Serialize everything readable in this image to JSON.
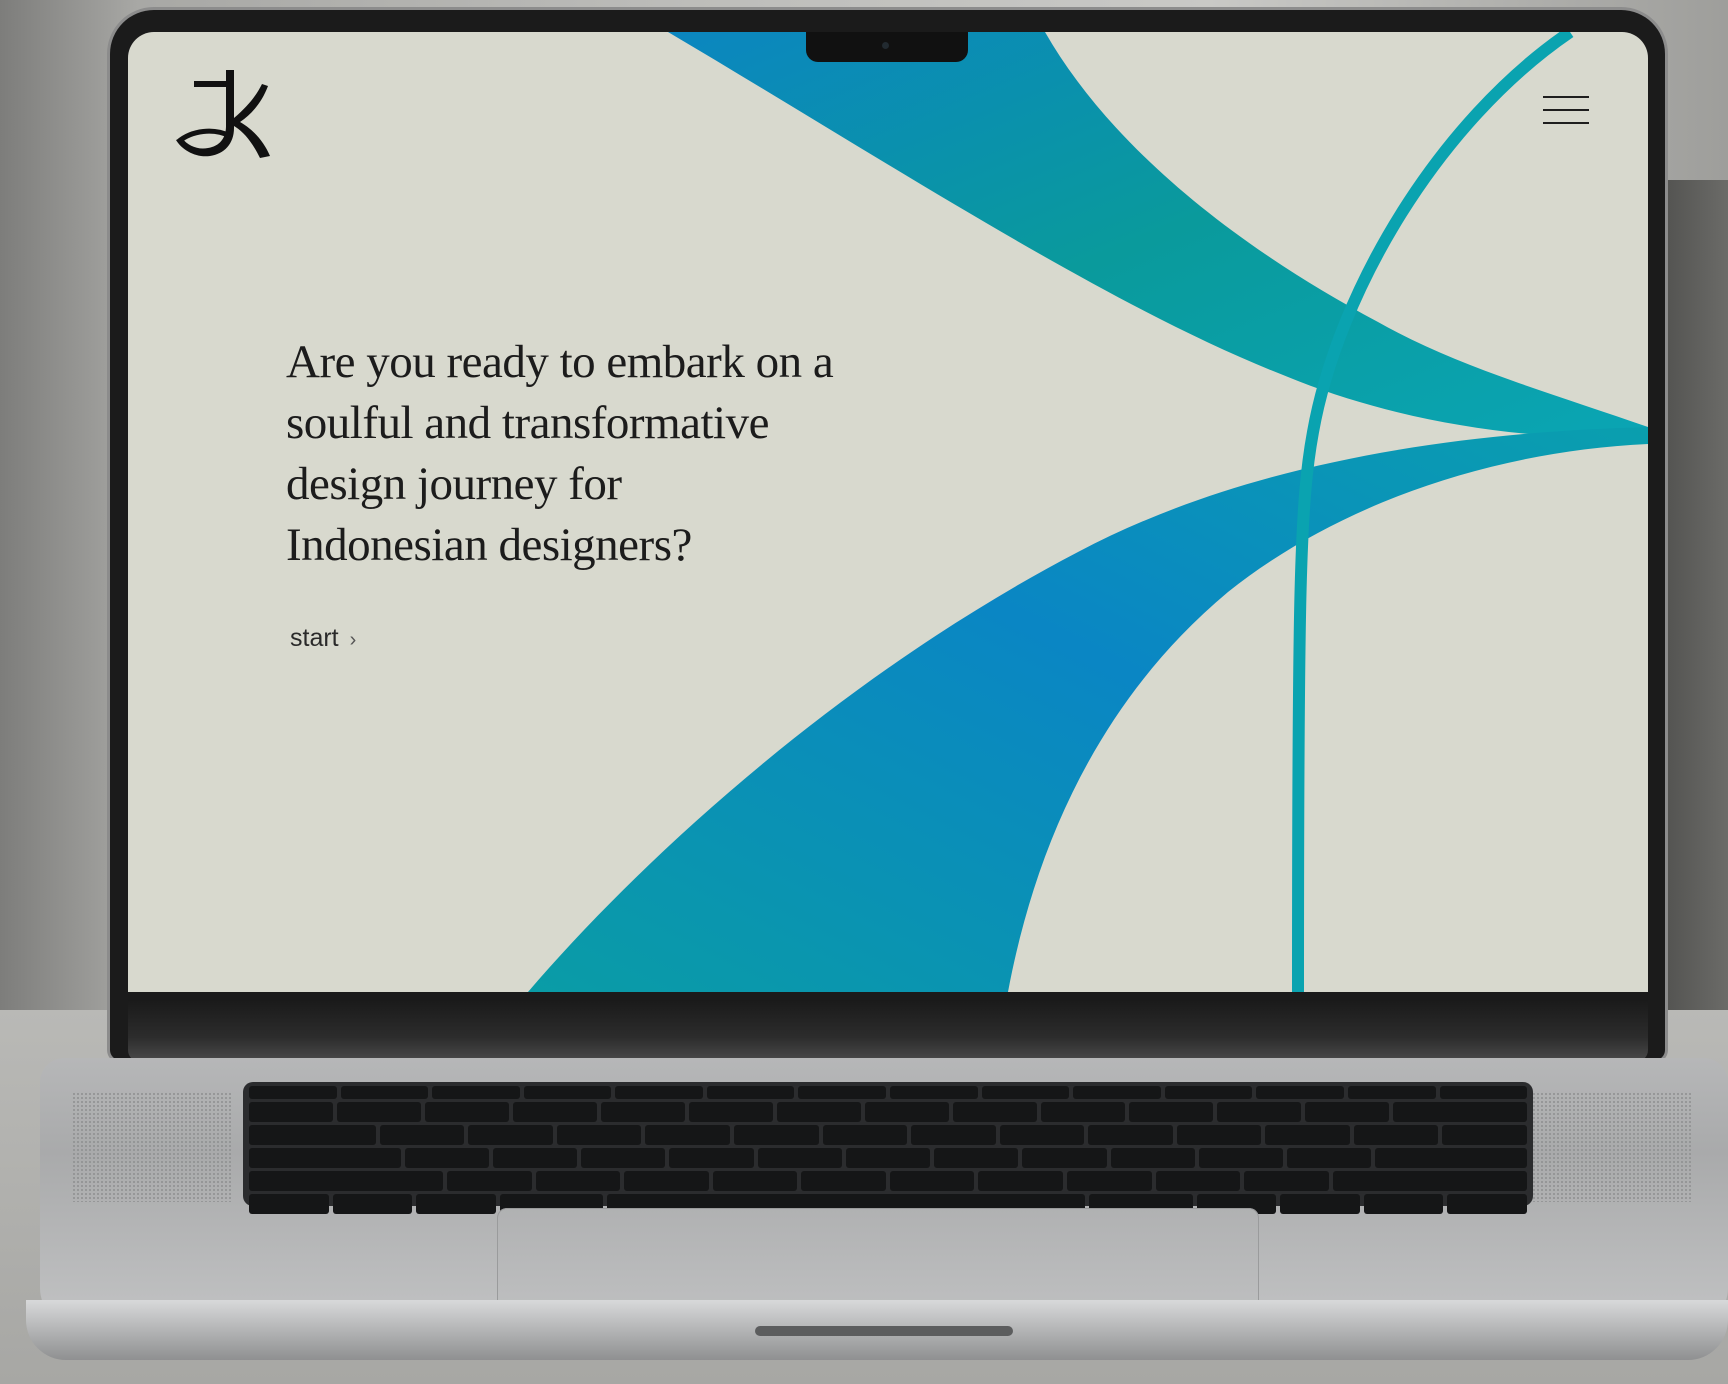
{
  "logo": {
    "icon": "jk-monogram-logo"
  },
  "nav": {
    "menu_icon": "hamburger-menu-icon"
  },
  "hero": {
    "lines": [
      "Are you ready to embark on a",
      "soulful and transformative",
      "design journey for",
      "Indonesian designers?"
    ],
    "cta_label": "start",
    "cta_icon": "chevron-right-icon",
    "cta_glyph": "›"
  },
  "colors": {
    "background": "#d8d9ce",
    "teal": "#0a9c9a",
    "blue": "#0a83c2",
    "text": "#1c1c1c"
  }
}
